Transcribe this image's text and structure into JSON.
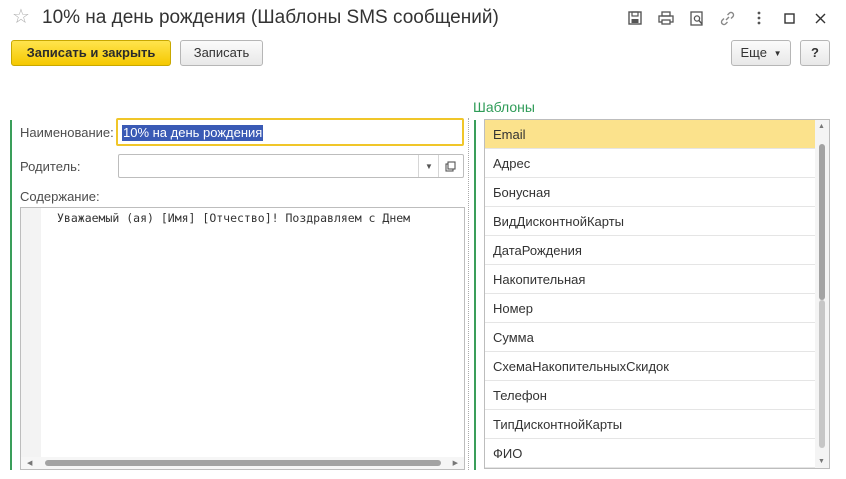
{
  "window": {
    "title": "10% на день рождения (Шаблоны SMS сообщений)",
    "icons": [
      "star-icon",
      "save-icon",
      "print-icon",
      "preview-icon",
      "link-icon",
      "more-vertical-icon",
      "maximize-icon",
      "close-icon"
    ]
  },
  "toolbar": {
    "save_close_label": "Записать и закрыть",
    "save_label": "Записать",
    "more_label": "Еще",
    "help_label": "?"
  },
  "form": {
    "name_label": "Наименование:",
    "name_value": "10% на день рождения",
    "parent_label": "Родитель:",
    "parent_value": "",
    "content_label": "Содержание:",
    "content_value": "Уважаемый (ая) [Имя] [Отчество]! Поздравляем с Днем"
  },
  "templates": {
    "title": "Шаблоны",
    "items": [
      "Email",
      "Адрес",
      "Бонусная",
      "ВидДисконтнойКарты",
      "ДатаРождения",
      "Накопительная",
      "Номер",
      "Сумма",
      "СхемаНакопительныхСкидок",
      "Телефон",
      "ТипДисконтнойКарты",
      "ФИО"
    ],
    "selected_index": 0
  },
  "colors": {
    "accent_green": "#3a9e5a",
    "primary_button": "#f5c800",
    "selected_row": "#fbe28c",
    "text_selection": "#3a5ab5"
  }
}
